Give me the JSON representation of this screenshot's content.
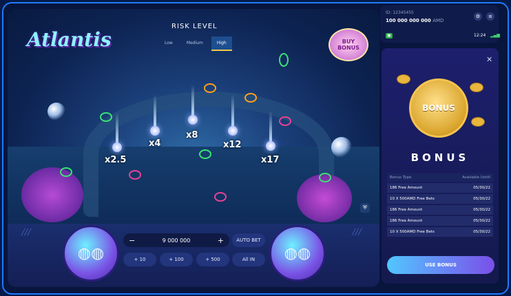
{
  "game": {
    "logo": "Atlantis",
    "risk_title": "RISK LEVEL",
    "risk_levels": [
      "Low",
      "Medium",
      "High"
    ],
    "buy_bonus": [
      "BUY",
      "BONUS"
    ],
    "multipliers": [
      "x2.5",
      "x4",
      "x8",
      "x12",
      "x17"
    ]
  },
  "controls": {
    "bet_amount": "9 000 000",
    "minus": "−",
    "plus": "+",
    "auto_bet": "AUTO BET",
    "inc1": "+ 10",
    "inc2": "+ 100",
    "inc3": "+ 500",
    "all_in": "All IN"
  },
  "account": {
    "id": "ID: 12345455",
    "balance": "100 000 000 000",
    "currency": "AMD",
    "time": "12:24"
  },
  "bonus": {
    "coin_label": "BONUS",
    "title": "BONUS",
    "headers": [
      "Bonus Type",
      "Available Untill"
    ],
    "rows": [
      [
        "186 Free Amount",
        "05/30/22"
      ],
      [
        "10 X 500AMD  Free Bets",
        "05/30/22"
      ],
      [
        "186 Free Amount",
        "05/30/22"
      ],
      [
        "186 Free Amount",
        "05/30/22"
      ],
      [
        "10 X 500AMD  Free Bets",
        "05/30/22"
      ]
    ],
    "use_label": "USE BONUS"
  },
  "colors": {
    "accent": "#1f7bff",
    "gold": "#f2c94c",
    "ring_green": "#3ae374",
    "ring_orange": "#ff9f1a",
    "ring_magenta": "#e84393"
  }
}
